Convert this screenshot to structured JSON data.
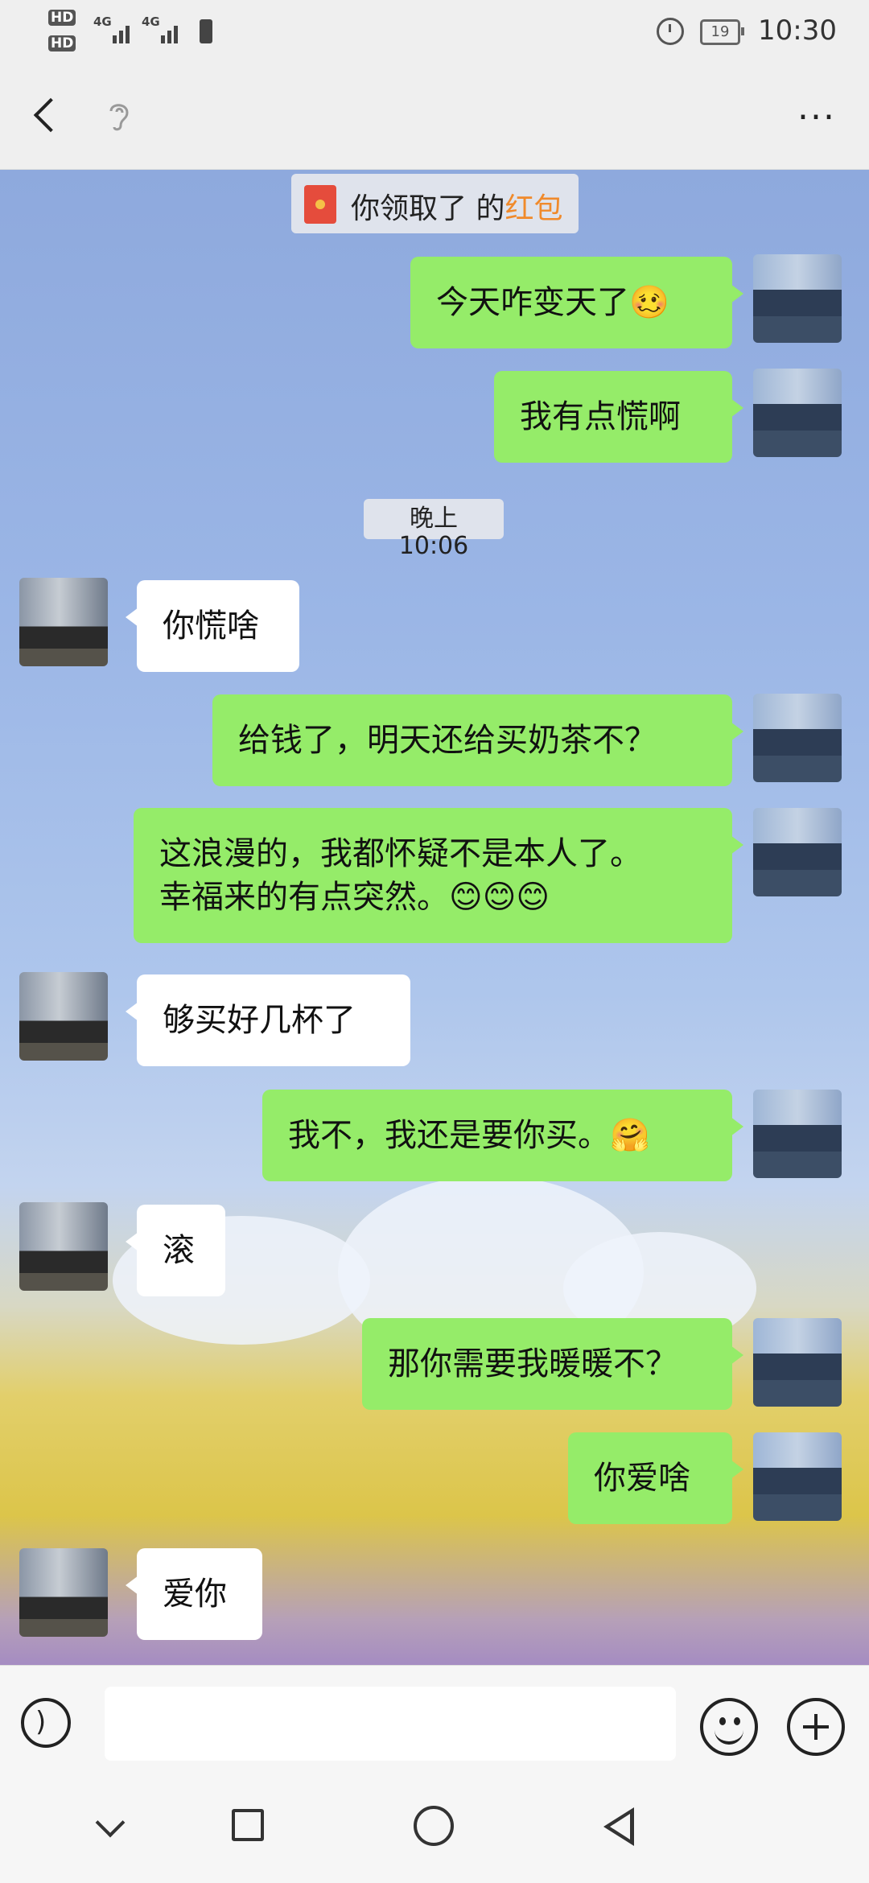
{
  "status_bar": {
    "hd1": "HD",
    "hd2": "HD",
    "net1": "4G",
    "net2": "4G",
    "battery": "19",
    "time": "10:30"
  },
  "title_bar": {
    "back_icon": "back-arrow-icon",
    "ear_icon": "ear-icon",
    "more_label": "..."
  },
  "system": {
    "red_packet_text": "你领取了 的",
    "red_packet_highlight": "红包",
    "timestamp": "晚上10:06"
  },
  "messages": [
    {
      "side": "me",
      "text": "今天咋变天了🥴"
    },
    {
      "side": "me",
      "text": "我有点慌啊"
    },
    {
      "side": "them",
      "text": "你慌啥"
    },
    {
      "side": "me",
      "text": "给钱了，明天还给买奶茶不？"
    },
    {
      "side": "me",
      "text": "这浪漫的，我都怀疑不是本人了。\n幸福来的有点突然。😊😊😊"
    },
    {
      "side": "them",
      "text": "够买好几杯了"
    },
    {
      "side": "me",
      "text": "我不，我还是要你买。🤗"
    },
    {
      "side": "them",
      "text": "滚"
    },
    {
      "side": "me",
      "text": "那你需要我暖暖不？"
    },
    {
      "side": "me",
      "text": "你爱啥"
    },
    {
      "side": "them",
      "text": "爱你"
    }
  ],
  "input_bar": {
    "voice_icon": "voice-icon",
    "input_value": "",
    "emoji_icon": "emoji-icon",
    "plus_icon": "plus-icon"
  },
  "nav_bar": {
    "icons": [
      "chevron-down-icon",
      "recent-apps-icon",
      "home-icon",
      "back-triangle-icon"
    ]
  }
}
